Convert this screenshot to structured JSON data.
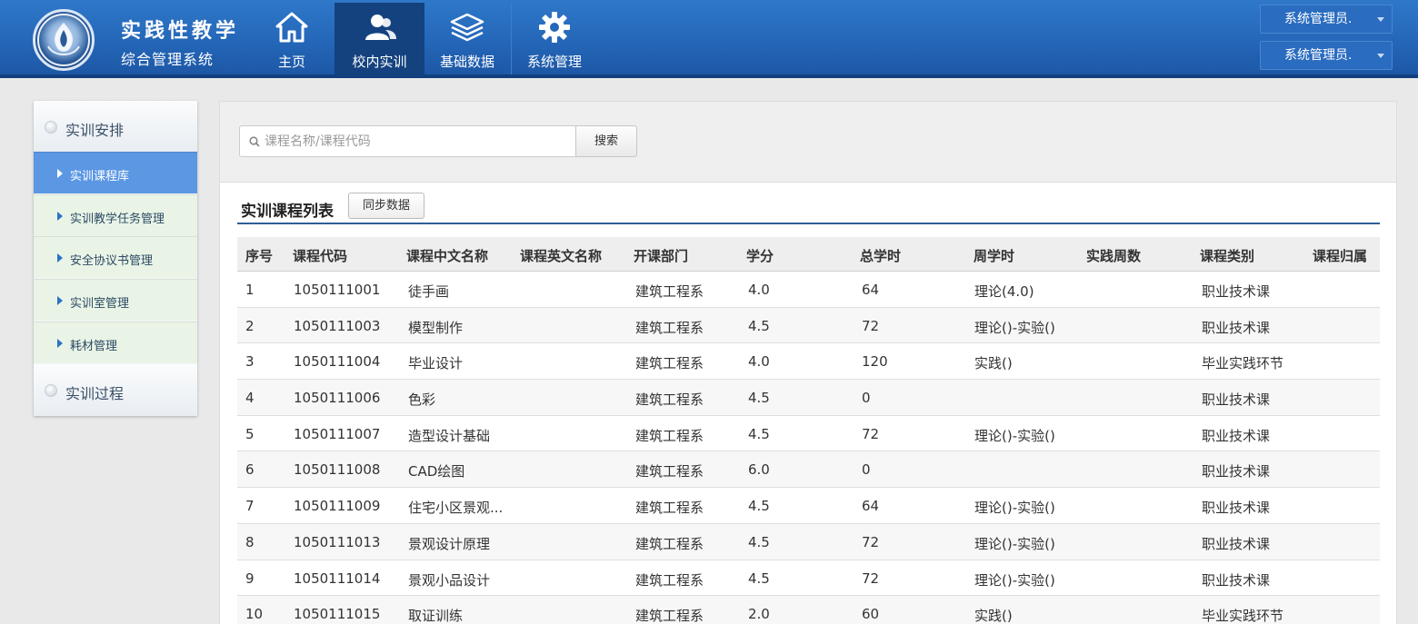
{
  "app": {
    "title": "实践性教学",
    "subtitle": "综合管理系统",
    "logo_icon": "school-emblem-icon"
  },
  "nav": [
    {
      "label": "主页",
      "icon": "home-icon",
      "active": false
    },
    {
      "label": "校内实训",
      "icon": "users-icon",
      "active": true
    },
    {
      "label": "基础数据",
      "icon": "layers-icon",
      "active": false
    },
    {
      "label": "系统管理",
      "icon": "gear-icon",
      "active": false
    }
  ],
  "user_menus": [
    "系统管理员.",
    "系统管理员."
  ],
  "sidebar": {
    "groups": [
      {
        "label": "实训安排"
      },
      {
        "label": "实训过程"
      }
    ],
    "items": [
      {
        "label": "实训课程库",
        "active": true
      },
      {
        "label": "实训教学任务管理",
        "active": false
      },
      {
        "label": "安全协议书管理",
        "active": false
      },
      {
        "label": "实训室管理",
        "active": false
      },
      {
        "label": "耗材管理",
        "active": false
      }
    ]
  },
  "search": {
    "placeholder": "课程名称/课程代码",
    "value": "",
    "button_label": "搜索"
  },
  "list": {
    "title": "实训课程列表",
    "sync_button": "同步数据"
  },
  "table": {
    "headers": [
      "序号",
      "课程代码",
      "课程中文名称",
      "课程英文名称",
      "开课部门",
      "学分",
      "总学时",
      "周学时",
      "实践周数",
      "课程类别",
      "课程归属"
    ],
    "rows": [
      [
        "1",
        "1050111001",
        "徒手画",
        "",
        "建筑工程系",
        "4.0",
        "64",
        "理论(4.0)",
        "",
        "职业技术课",
        ""
      ],
      [
        "2",
        "1050111003",
        "模型制作",
        "",
        "建筑工程系",
        "4.5",
        "72",
        "理论()-实验()",
        "",
        "职业技术课",
        ""
      ],
      [
        "3",
        "1050111004",
        "毕业设计",
        "",
        "建筑工程系",
        "4.0",
        "120",
        "实践()",
        "",
        "毕业实践环节",
        ""
      ],
      [
        "4",
        "1050111006",
        "色彩",
        "",
        "建筑工程系",
        "4.5",
        "0",
        "",
        "",
        "职业技术课",
        ""
      ],
      [
        "5",
        "1050111007",
        "造型设计基础",
        "",
        "建筑工程系",
        "4.5",
        "72",
        "理论()-实验()",
        "",
        "职业技术课",
        ""
      ],
      [
        "6",
        "1050111008",
        "CAD绘图",
        "",
        "建筑工程系",
        "6.0",
        "0",
        "",
        "",
        "职业技术课",
        ""
      ],
      [
        "7",
        "1050111009",
        "住宅小区景观...",
        "",
        "建筑工程系",
        "4.5",
        "64",
        "理论()-实验()",
        "",
        "职业技术课",
        ""
      ],
      [
        "8",
        "1050111013",
        "景观设计原理",
        "",
        "建筑工程系",
        "4.5",
        "72",
        "理论()-实验()",
        "",
        "职业技术课",
        ""
      ],
      [
        "9",
        "1050111014",
        "景观小品设计",
        "",
        "建筑工程系",
        "4.5",
        "72",
        "理论()-实验()",
        "",
        "职业技术课",
        ""
      ],
      [
        "10",
        "1050111015",
        "取证训练",
        "",
        "建筑工程系",
        "2.0",
        "60",
        "实践()",
        "",
        "毕业实践环节",
        ""
      ]
    ]
  }
}
